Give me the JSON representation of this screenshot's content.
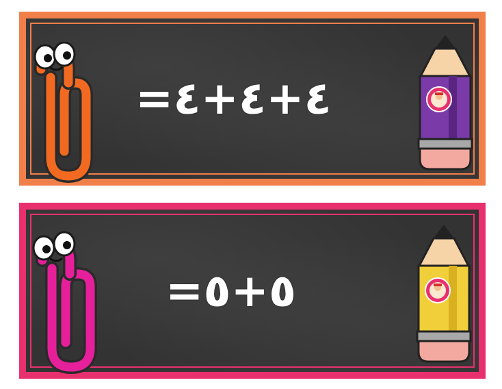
{
  "cards": [
    {
      "equation": "=٤+٤+٤",
      "clip_color": "#f26a21",
      "pencil_color": "#7a3aa8",
      "border_color": "#f07f4a",
      "icons": {
        "clip": "paperclip-icon",
        "pencil": "pencil-icon",
        "badge": "logo-badge-icon"
      }
    },
    {
      "equation": "=٥+٥",
      "clip_color": "#e5209a",
      "pencil_color": "#f0cf3a",
      "border_color": "#e8306f",
      "icons": {
        "clip": "paperclip-icon",
        "pencil": "pencil-icon",
        "badge": "logo-badge-icon"
      }
    }
  ]
}
